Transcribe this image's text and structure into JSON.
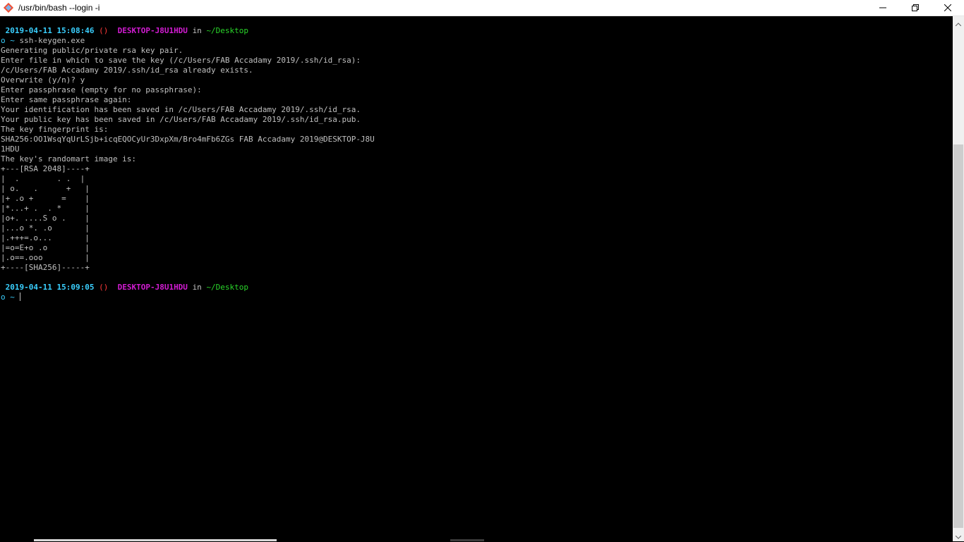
{
  "window": {
    "title": "/usr/bin/bash --login -i",
    "icon": "git-bash-icon",
    "controls": [
      "minimize-icon",
      "restore-icon",
      "close-icon"
    ]
  },
  "colors": {
    "timestamp": "#3ad0ff",
    "hostname": "#d21cd2",
    "path": "#2ad52a",
    "branch_symbol": "#ff3a3a",
    "text": "#c0c0c0",
    "background": "#000000"
  },
  "terminal": {
    "prompt1": {
      "timestamp": "2019-04-11 15:08:46",
      "symbol": "()",
      "host": "DESKTOP-J8U1HDU",
      "in": "in",
      "path": "~/Desktop",
      "prompt": "o ~",
      "command": "ssh-keygen.exe"
    },
    "output": [
      "Generating public/private rsa key pair.",
      "Enter file in which to save the key (/c/Users/FAB Accadamy 2019/.ssh/id_rsa):",
      "/c/Users/FAB Accadamy 2019/.ssh/id_rsa already exists.",
      "Overwrite (y/n)? y",
      "Enter passphrase (empty for no passphrase):",
      "Enter same passphrase again:",
      "Your identification has been saved in /c/Users/FAB Accadamy 2019/.ssh/id_rsa.",
      "Your public key has been saved in /c/Users/FAB Accadamy 2019/.ssh/id_rsa.pub.",
      "The key fingerprint is:",
      "SHA256:OO1WsqYqUrLSjb+icqEQOCyUr3DxpXm/Bro4mFb6ZGs FAB Accadamy 2019@DESKTOP-J8U",
      "1HDU",
      "The key's randomart image is:",
      "+---[RSA 2048]----+",
      "|  .        . .  |",
      "| o.   .      +   |",
      "|+ .o +      =    |",
      "|*...+ .  . *     |",
      "|o+. ....S o .    |",
      "|...o *. .o       |",
      "|.+++=.o...       |",
      "|=o=E+o .o        |",
      "|.o==.ooo         |",
      "+----[SHA256]-----+"
    ],
    "prompt2": {
      "timestamp": "2019-04-11 15:09:05",
      "symbol": "()",
      "host": "DESKTOP-J8U1HDU",
      "in": "in",
      "path": "~/Desktop",
      "prompt": "o ~"
    }
  }
}
